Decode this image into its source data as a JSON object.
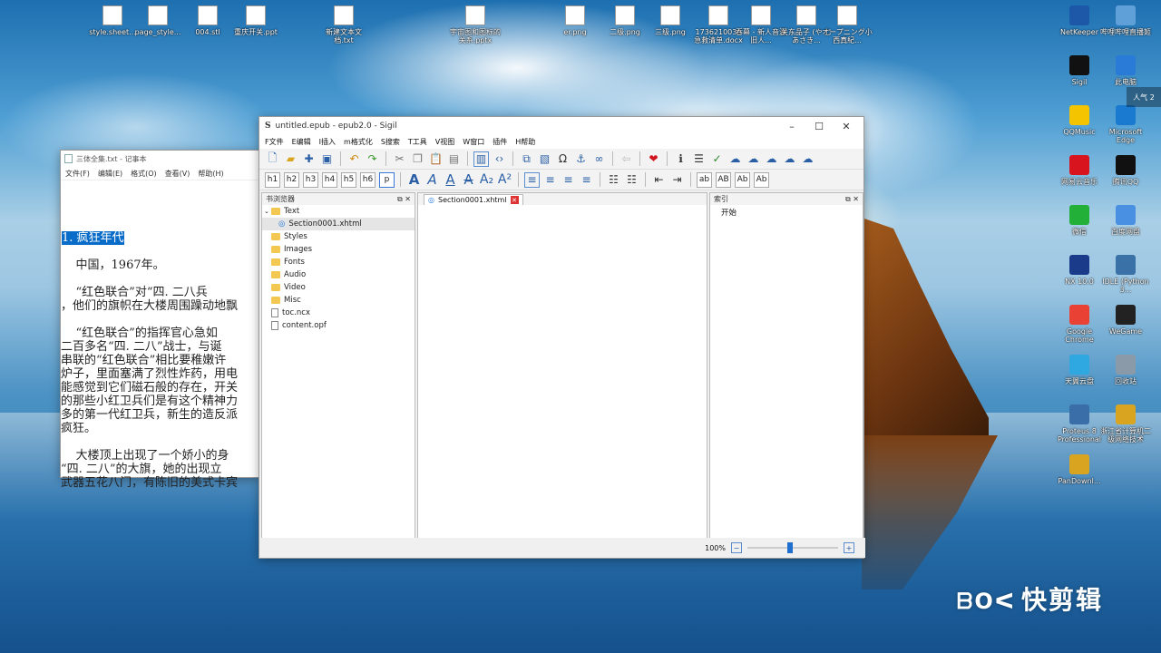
{
  "desktop_top": [
    {
      "label": "style.sheet..."
    },
    {
      "label": "page_style..."
    },
    {
      "label": "004.stl"
    },
    {
      "label": "重庆开关.ppt"
    },
    {
      "label": "新建文本文档.txt"
    },
    {
      "label": "宇宙图和图标的关系.pptx"
    },
    {
      "label": "er.png"
    },
    {
      "label": "二级.png"
    },
    {
      "label": "三级.png"
    },
    {
      "label": "1736210039急救清单.docx"
    },
    {
      "label": "吞幕 - 新人音源旧人..."
    },
    {
      "label": "关东品子 (や じ あさき..."
    },
    {
      "label": "オープニング小西真紀..."
    }
  ],
  "desktop_right": [
    {
      "label": "NetKeeper"
    },
    {
      "label": "哔哩哔哩直播姬"
    },
    {
      "label": "Sigil"
    },
    {
      "label": "此电脑"
    },
    {
      "label": "QQMusic"
    },
    {
      "label": "Microsoft Edge"
    },
    {
      "label": "网易云音乐"
    },
    {
      "label": "腾讯QQ"
    },
    {
      "label": "微信"
    },
    {
      "label": "百度网盘"
    },
    {
      "label": "NX 10.0"
    },
    {
      "label": "IDLE (Python 3..."
    },
    {
      "label": "Google Chrome"
    },
    {
      "label": "WeGame"
    },
    {
      "label": "天翼云盘"
    },
    {
      "label": "回收站"
    },
    {
      "label": "Proteus 8 Professional"
    },
    {
      "label": "浙江省计算机二级网络技术"
    },
    {
      "label": "PanDownl..."
    }
  ],
  "weather_snippet": "人气 2",
  "notepad": {
    "title": "三体全集.txt - 记事本",
    "menu": [
      "文件(F)",
      "编辑(E)",
      "格式(O)",
      "查看(V)",
      "帮助(H)"
    ],
    "heading": "1. 疯狂年代",
    "lines": [
      "",
      "    中国，1967年。",
      "",
      "    “红色联合”对“四. 二八兵",
      "，他们的旗帜在大楼周围躁动地飘",
      "",
      "    “红色联合”的指挥官心急如",
      "二百多名“四. 二八”战士，与诞",
      "串联的“红色联合”相比要稚嫩许",
      "炉子，里面塞满了烈性炸药，用电",
      "能感觉到它们磁石般的存在，开关",
      "的那些小红卫兵们是有这个精神力",
      "多的第一代红卫兵，新生的造反派",
      "疯狂。",
      "",
      "    大楼顶上出现了一个娇小的身",
      "“四. 二八”的大旗，她的出现立",
      "武器五花八门，有陈旧的美式卡宾"
    ]
  },
  "sigil": {
    "title": "untitled.epub - epub2.0 - Sigil",
    "menu": [
      "F文件",
      "E编辑",
      "I插入",
      "m格式化",
      "S搜索",
      "T工具",
      "V视图",
      "W窗口",
      "插件",
      "H帮助"
    ],
    "heading_buttons": [
      "h1",
      "h2",
      "h3",
      "h4",
      "h5",
      "h6",
      "p"
    ],
    "case_buttons": [
      "ab",
      "AB",
      "Ab",
      "Ab"
    ],
    "browser_title": "书浏览器",
    "tree": [
      {
        "label": "Text",
        "type": "folder",
        "indent": 0
      },
      {
        "label": "Section0001.xhtml",
        "type": "page",
        "indent": 1
      },
      {
        "label": "Styles",
        "type": "folder",
        "indent": 0
      },
      {
        "label": "Images",
        "type": "folder",
        "indent": 0
      },
      {
        "label": "Fonts",
        "type": "folder",
        "indent": 0
      },
      {
        "label": "Audio",
        "type": "folder",
        "indent": 0
      },
      {
        "label": "Video",
        "type": "folder",
        "indent": 0
      },
      {
        "label": "Misc",
        "type": "folder",
        "indent": 0
      },
      {
        "label": "toc.ncx",
        "type": "doc",
        "indent": 0
      },
      {
        "label": "content.opf",
        "type": "doc",
        "indent": 0
      }
    ],
    "editor_tab": "Section0001.xhtml",
    "index_title": "索引",
    "index_items": [
      "开始"
    ],
    "zoom": "100%"
  },
  "watermark": "快剪辑"
}
